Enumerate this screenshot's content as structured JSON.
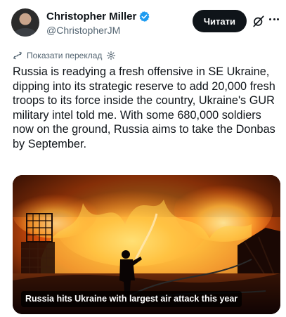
{
  "author": {
    "display_name": "Christopher Miller",
    "handle": "@ChristopherJM",
    "verified": true
  },
  "header": {
    "read_button_label": "Читати",
    "icons": [
      "grok-icon",
      "more-icon"
    ]
  },
  "translate": {
    "label": "Показати переклад"
  },
  "tweet": {
    "text": "Russia is readying a fresh offensive in SE Ukraine, dipping into its strategic reserve to add 20,000 fresh troops to its force inside the country, Ukraine's GUR military intel told me. With some 680,000 soldiers now on the ground, Russia aims to take the Donbas by September."
  },
  "media": {
    "caption": "Russia hits Ukraine with largest air attack this year",
    "description_icon": "fire-scene-photo"
  },
  "colors": {
    "accent": "#1d9bf0",
    "text_primary": "#0f1419",
    "text_secondary": "#536471",
    "button_bg": "#0f1419"
  }
}
